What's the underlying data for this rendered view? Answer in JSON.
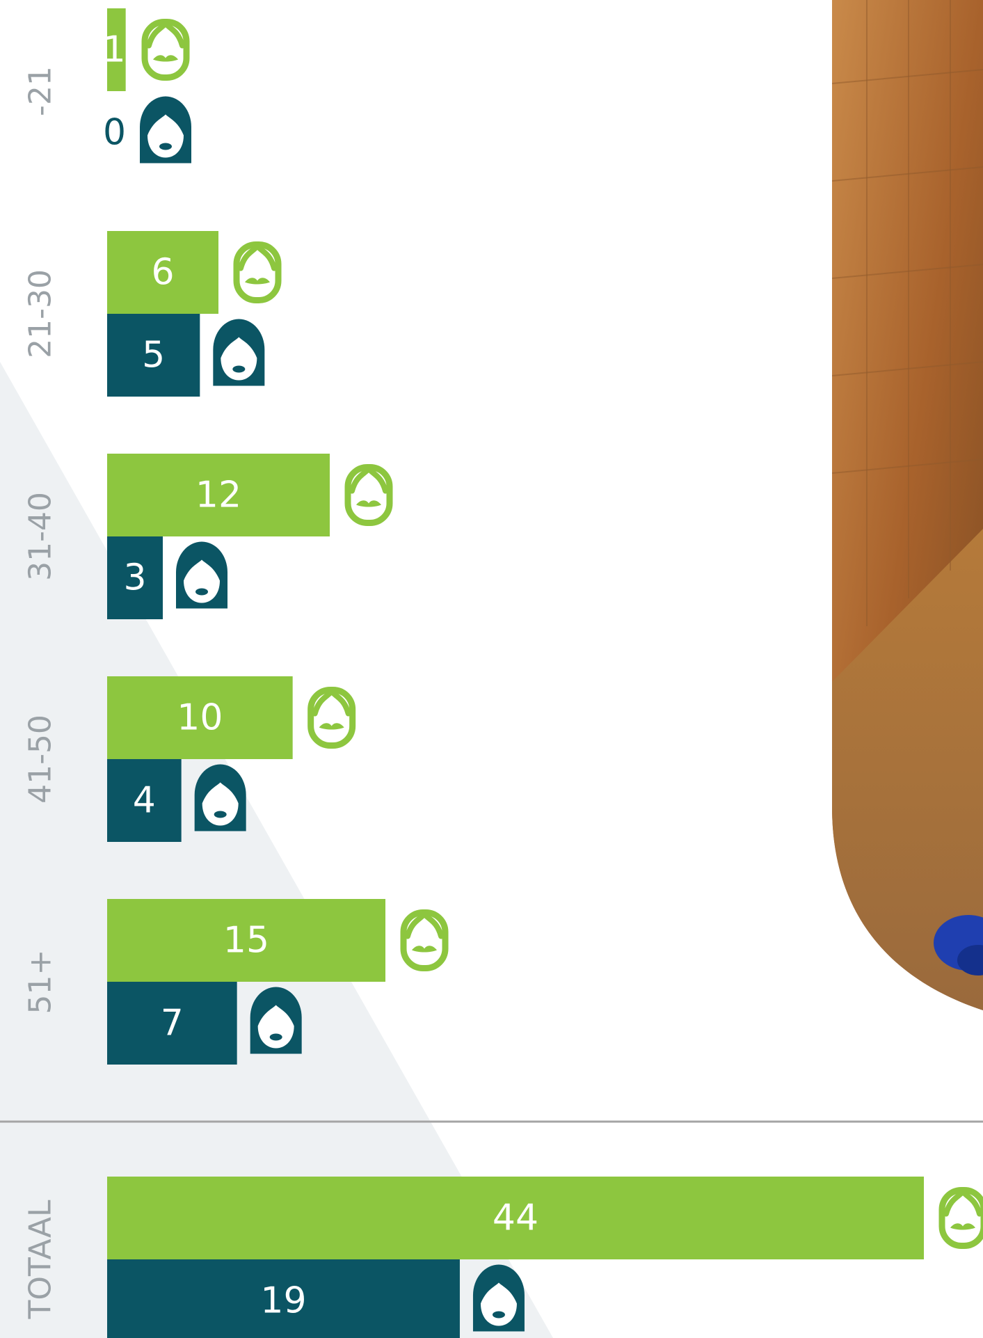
{
  "chart_data": {
    "type": "bar",
    "orientation": "horizontal",
    "categories": [
      "-21",
      "21-30",
      "31-40",
      "41-50",
      "51+",
      "TOTAAL"
    ],
    "series": [
      {
        "values": [
          1,
          6,
          12,
          10,
          15,
          44
        ],
        "icon": "male-face-icon",
        "color": "#8dc63f"
      },
      {
        "values": [
          0,
          5,
          3,
          4,
          7,
          19
        ],
        "icon": "female-face-icon",
        "color": "#0b5564"
      }
    ],
    "group_scale_max": 15,
    "total_scale_max": 44
  },
  "colors": {
    "male": "#8dc63f",
    "female": "#0b5564",
    "label_gray": "#9aa1a6",
    "bg_triangle": "#eef1f3",
    "divider": "#a5a5a5"
  }
}
